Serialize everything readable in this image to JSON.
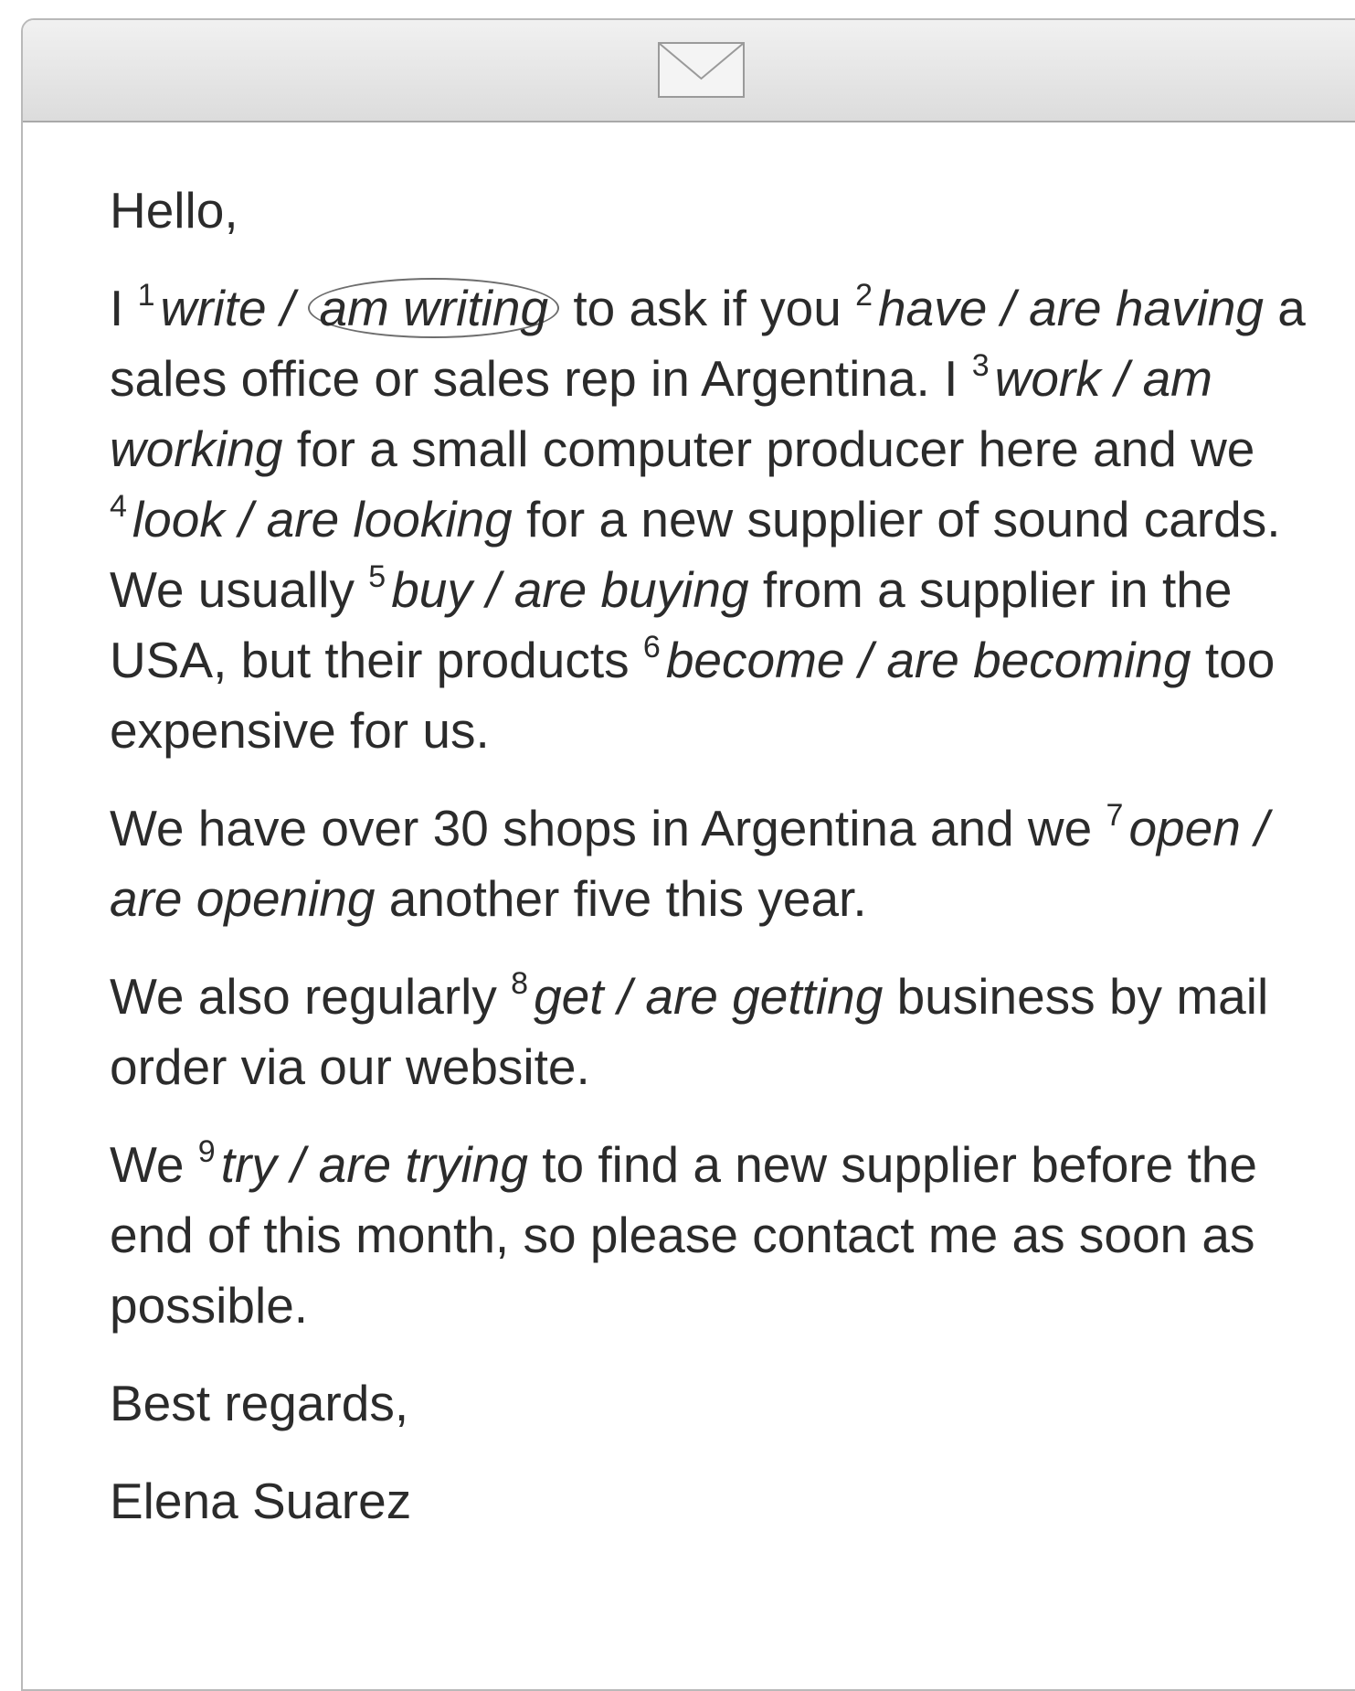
{
  "email": {
    "greeting": "Hello,",
    "p1": {
      "a": "I ",
      "n1": "1",
      "c1a": "write / ",
      "c1b": "am writing",
      "b": " to ask if you ",
      "n2": "2",
      "c2": "have / are having",
      "c": " a sales office or sales rep in Argentina. I ",
      "n3": "3",
      "c3": "work / am working",
      "d": " for a small computer producer here and we ",
      "n4": "4",
      "c4": "look / are looking",
      "e": " for a new supplier of sound cards. We usually ",
      "n5": "5",
      "c5": "buy / are buying",
      "f": " from a supplier in the USA, but their products ",
      "n6": "6",
      "c6": "become / are becoming",
      "g": " too expensive for us."
    },
    "p2": {
      "a": "We have over 30 shops in Argentina and we ",
      "n7": "7",
      "c7": "open / are opening",
      "b": " another five this year."
    },
    "p3": {
      "a": "We also regularly ",
      "n8": "8",
      "c8": "get / are getting",
      "b": " business by mail order via our website."
    },
    "p4": {
      "a": "We ",
      "n9": "9",
      "c9": "try / are trying",
      "b": " to find a new supplier before the end of this month, so please contact me as soon as possible."
    },
    "closing": "Best regards,",
    "signature": "Elena Suarez"
  },
  "icons": {
    "header": "envelope-icon"
  }
}
